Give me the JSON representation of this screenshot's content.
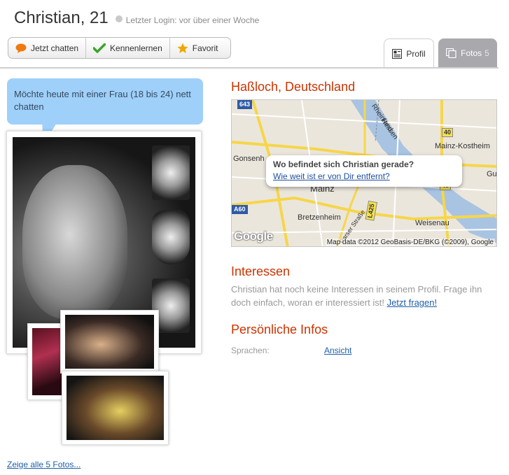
{
  "profile": {
    "name": "Christian, 21",
    "last_login": "Letzter Login: vor über einer Woche"
  },
  "actions": [
    {
      "label": "Jetzt chatten",
      "icon": "speech-bubble-icon",
      "color": "#f07a10"
    },
    {
      "label": "Kennenlernen",
      "icon": "checkmark-icon",
      "color": "#3aa52a"
    },
    {
      "label": "Favorit",
      "icon": "star-icon",
      "color": "#f0a800"
    }
  ],
  "tabs": {
    "profile": {
      "label": "Profil",
      "icon": "profile-card-icon"
    },
    "photos": {
      "label": "Fotos",
      "count": "5",
      "icon": "photos-icon"
    }
  },
  "bubble": {
    "text": "Möchte heute mit einer Frau (18 bis 24) nett chatten"
  },
  "photos": {
    "all_link": "Zeige alle 5 Fotos..."
  },
  "location": {
    "title": "Haßloch, Deutschland",
    "map": {
      "popup_question": "Wo befindet sich Christian gerade?",
      "popup_link": "Wie weit ist er von Dir entfernt?",
      "cities": [
        "Gonsenh",
        "Mainz-Kostheim",
        "Mainz",
        "Bretzenheim",
        "Weisenau",
        "Gu"
      ],
      "roads": [
        "643",
        "40",
        "40",
        "A60",
        "L425"
      ],
      "river_labels": [
        "Rheinland",
        "Hessen"
      ],
      "street": "Parser Straße",
      "logo": "Google",
      "copyright": "Map data ©2012 GeoBasis-DE/BKG (©2009), Google"
    }
  },
  "interests": {
    "title": "Interessen",
    "text": "Christian hat noch keine Interessen in seinem Profil. Frage ihn doch einfach, woran er interessiert ist!",
    "link": "Jetzt fragen!"
  },
  "personal": {
    "title": "Persönliche Infos",
    "rows": [
      {
        "label": "Sprachen:",
        "value": "Ansicht"
      }
    ]
  },
  "colors": {
    "accent_heading": "#cc3300",
    "link": "#1f5fa8",
    "bubble": "#9fd0f9",
    "tab_inactive": "#a9a9ad"
  }
}
